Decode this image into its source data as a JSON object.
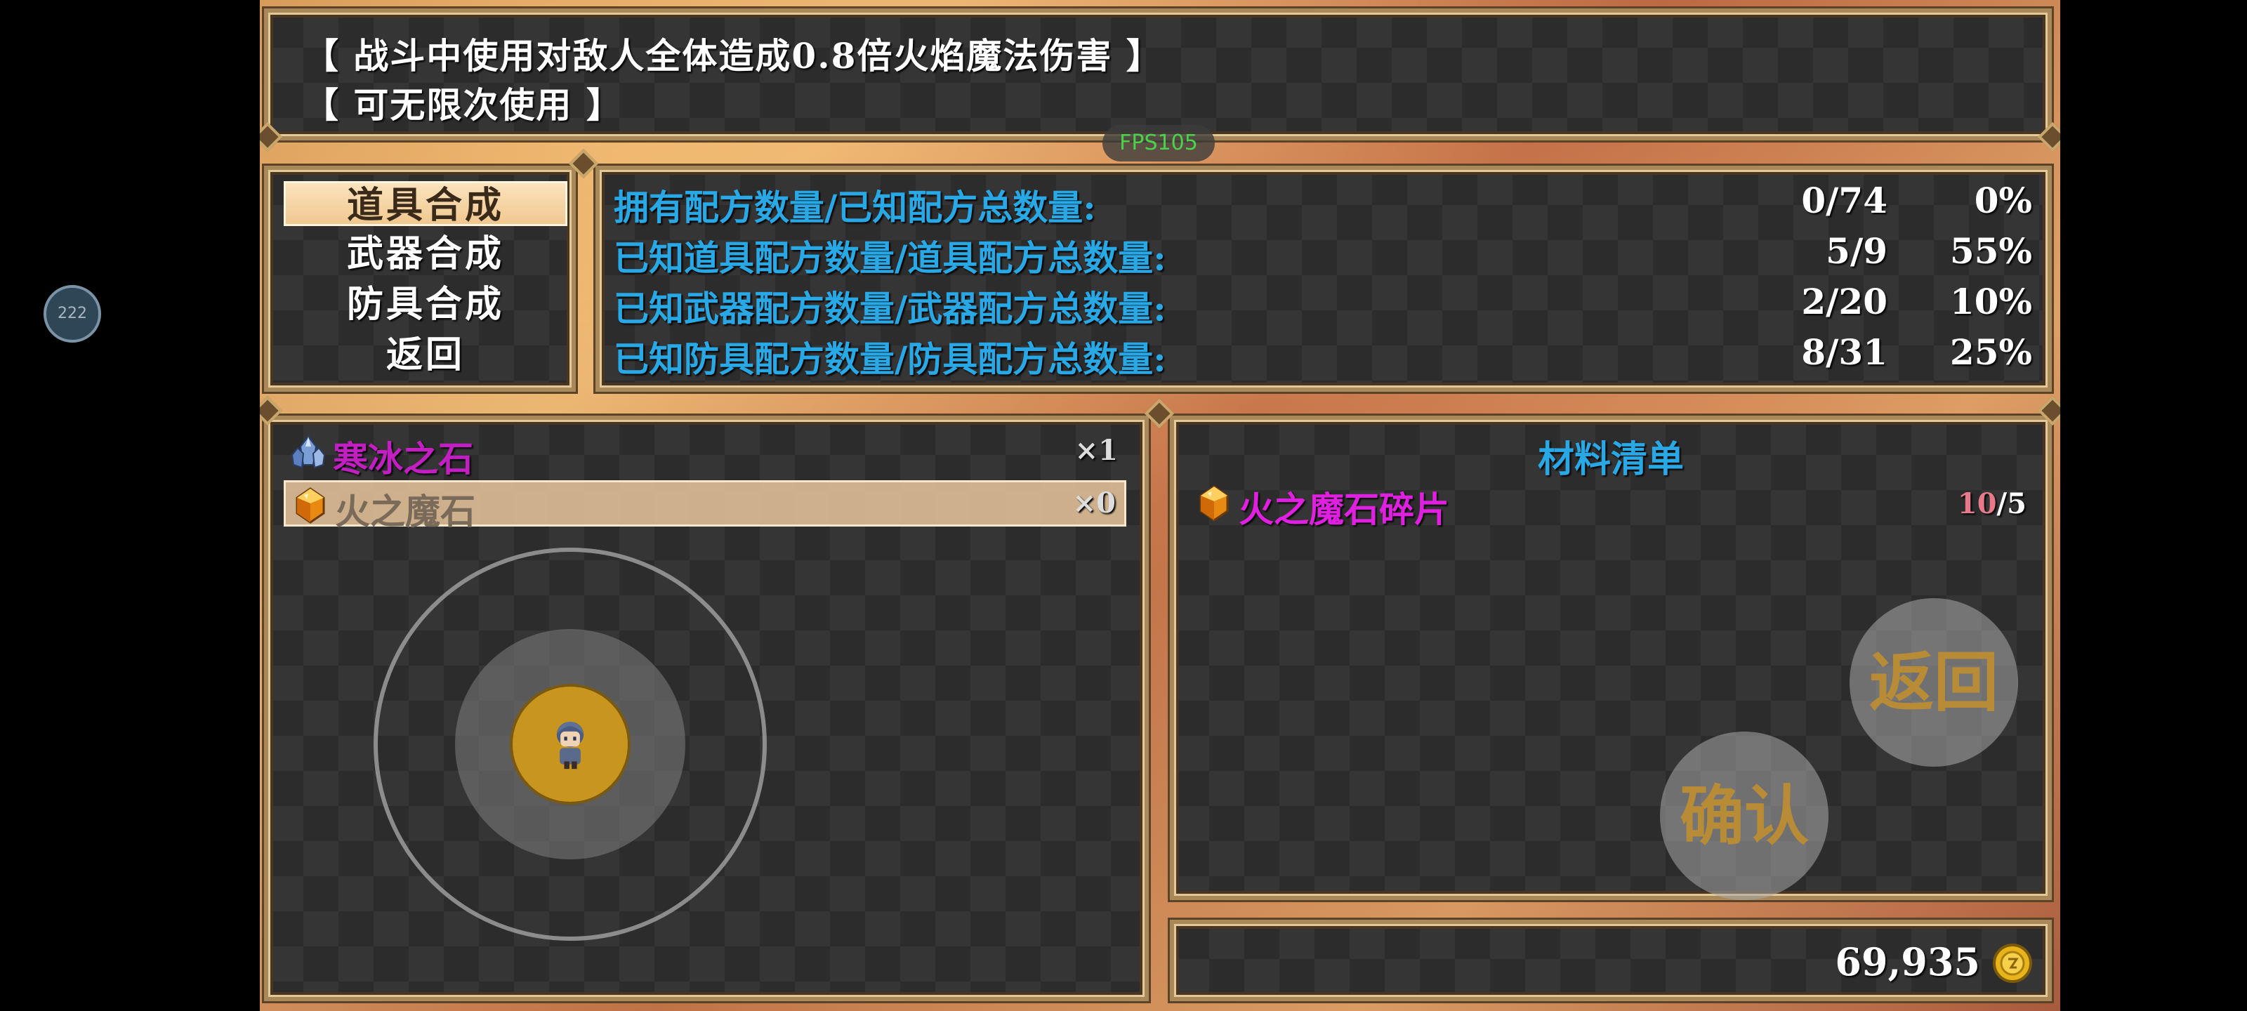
{
  "overlay": {
    "fps": "FPS105",
    "side_button": "222"
  },
  "description": {
    "line1": "【 战斗中使用对敌人全体造成0.8倍火焰魔法伤害 】",
    "line2": "【 可无限次使用 】"
  },
  "categories": [
    {
      "label": "道具合成",
      "selected": true
    },
    {
      "label": "武器合成",
      "selected": false
    },
    {
      "label": "防具合成",
      "selected": false
    },
    {
      "label": "返回",
      "selected": false
    }
  ],
  "stats": [
    {
      "label": "拥有配方数量/已知配方总数量:",
      "ratio": "0/74",
      "percent": "0%"
    },
    {
      "label": "已知道具配方数量/道具配方总数量:",
      "ratio": "5/9",
      "percent": "55%"
    },
    {
      "label": "已知武器配方数量/武器配方总数量:",
      "ratio": "2/20",
      "percent": "10%"
    },
    {
      "label": "已知防具配方数量/防具配方总数量:",
      "ratio": "8/31",
      "percent": "25%"
    }
  ],
  "recipes": [
    {
      "name": "寒冰之石",
      "quantity": "×1",
      "icon": "ice-crystal-icon",
      "color": "#c21fc2",
      "selected": false
    },
    {
      "name": "火之魔石",
      "quantity": "×0",
      "icon": "fire-gem-icon",
      "color": "#7a6a5a",
      "selected": true
    }
  ],
  "materials": {
    "title": "材料清单",
    "items": [
      {
        "name": "火之魔石碎片",
        "owned": "10",
        "required": "/5",
        "icon": "fire-gem-icon",
        "color": "#e020e0"
      }
    ]
  },
  "buttons": {
    "back": "返回",
    "confirm": "确认"
  },
  "gold": {
    "amount": "69,935",
    "icon": "gold-coin-icon"
  },
  "colors": {
    "stat_label": "#29a8e6",
    "recipe_selected_bg": "#f0cda0",
    "joystick_knob": "#c8961f"
  }
}
